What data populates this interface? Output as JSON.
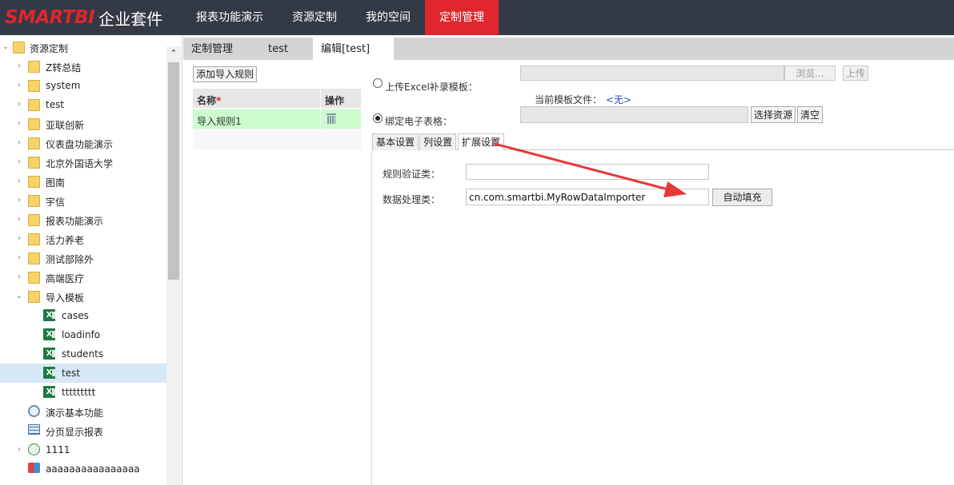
{
  "brand": {
    "logo_text": "SMARTBI",
    "suite_text": "企业套件",
    "accent": "#e0252d"
  },
  "nav": {
    "items": [
      "报表功能演示",
      "资源定制",
      "我的空间",
      "定制管理"
    ],
    "active_index": 3
  },
  "tree": {
    "root_label": "资源定制",
    "folders": [
      "Z转总结",
      "system",
      "test",
      "亚联创新",
      "仪表盘功能演示",
      "北京外国语大学",
      "图南",
      "宇信",
      "报表功能演示",
      "活力养老",
      "测试部除外",
      "高端医疗",
      "导入模板"
    ],
    "templates": [
      "cases",
      "loadinfo",
      "students",
      "test",
      "ttttttttt"
    ],
    "selected_template": "test",
    "other_items": [
      "演示基本功能",
      "分页显示报表",
      "1111",
      "aaaaaaaaaaaaaaaa"
    ]
  },
  "tabs": {
    "items": [
      "定制管理",
      "test",
      "编辑[test]"
    ],
    "close_glyph": "✕"
  },
  "rules": {
    "add_button": "添加导入规则",
    "header_name": "名称",
    "required_mark": "*",
    "header_action": "操作",
    "rows": [
      "导入规则1"
    ]
  },
  "upload": {
    "radio_label": "上传Excel补录模板：",
    "browse_button": "浏览...",
    "upload_button": "上传",
    "current_file_label": "当前模板文件：",
    "current_file_value": "<无>"
  },
  "bind": {
    "radio_label": "绑定电子表格：",
    "select_button": "选择资源",
    "clear_button": "清空"
  },
  "subtabs": {
    "items": [
      "基本设置",
      "列设置",
      "扩展设置"
    ],
    "active_index": 2
  },
  "extension": {
    "validator_label": "规则验证类：",
    "validator_value": "",
    "processor_label": "数据处理类：",
    "processor_value": "cn.com.smartbi.MyRowDataImporter",
    "autofill_button": "自动填充"
  }
}
